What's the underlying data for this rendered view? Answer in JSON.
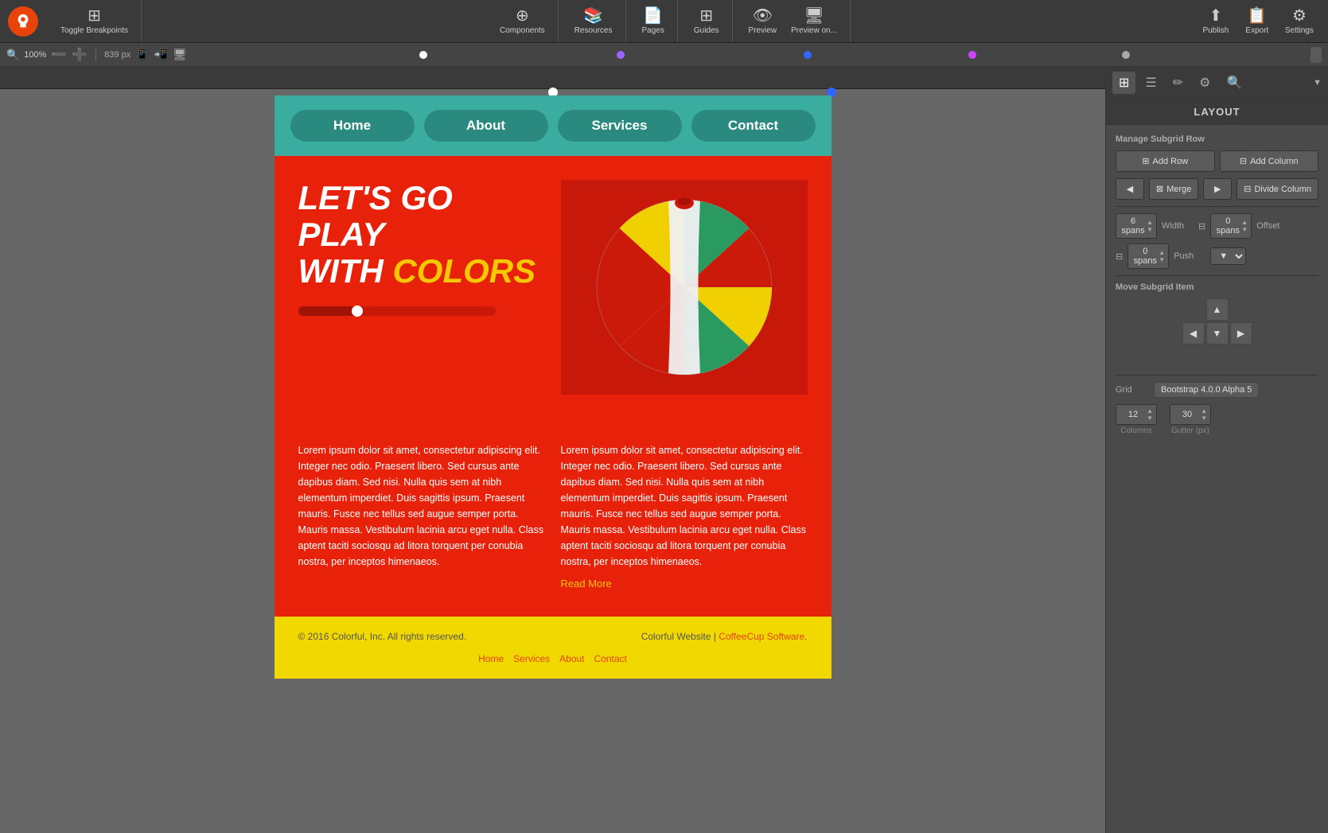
{
  "toolbar": {
    "logo_aria": "coffeecup-logo",
    "toggle_breakpoints": "Toggle Breakpoints",
    "components_label": "Components",
    "resources_label": "Resources",
    "pages_label": "Pages",
    "guides_label": "Guides",
    "preview_label": "Preview",
    "preview_on_label": "Preview on...",
    "publish_label": "Publish",
    "export_label": "Export",
    "settings_label": "Settings"
  },
  "subbar": {
    "zoom": "100%",
    "px_label": "839 px"
  },
  "site": {
    "nav": {
      "items": [
        "Home",
        "About",
        "Services",
        "Contact"
      ]
    },
    "hero": {
      "title_line1": "LET'S GO PLAY",
      "title_line2_prefix": "WITH ",
      "title_line2_highlight": "COLORS"
    },
    "content": {
      "lorem": "Lorem ipsum dolor sit amet, consectetur adipiscing elit. Integer nec odio. Praesent libero. Sed cursus ante dapibus diam. Sed nisi. Nulla quis sem at nibh elementum imperdiet. Duis sagittis ipsum. Praesent mauris. Fusce nec tellus sed augue semper porta. Mauris massa. Vestibulum lacinia arcu eget nulla. Class aptent taciti sociosqu ad litora torquent per conubia nostra, per inceptos himenaeos."
    },
    "read_more": "Read More",
    "footer": {
      "copyright": "© 2016 Colorful, Inc. All rights reserved.",
      "brand": "Colorful Website | ",
      "brand_link": "CoffeeCup Software",
      "brand_suffix": ".",
      "nav_home": "Home",
      "nav_services": "Services",
      "nav_about": "About",
      "nav_contact": "Contact"
    }
  },
  "panel": {
    "tabs": [
      "grid-icon",
      "list-icon",
      "pen-icon",
      "gear-icon",
      "search-icon"
    ],
    "title": "LAYOUT",
    "manage_subgrid_row": "Manage Subgrid Row",
    "add_row": "Add Row",
    "add_column": "Add Column",
    "merge": "Merge",
    "divide_column": "Divide Column",
    "spans_label": "6 spans",
    "width_label": "Width",
    "offset_label": "Offset",
    "offset_spans": "0 spans",
    "push_label": "Push",
    "push_spans": "0 spans",
    "move_subgrid_item": "Move Subgrid Item",
    "grid_label": "Grid",
    "grid_value": "Bootstrap 4.0.0 Alpha 5",
    "columns": "12",
    "gutter": "30",
    "columns_label": "Columns",
    "gutter_label": "Gutter (px)"
  }
}
